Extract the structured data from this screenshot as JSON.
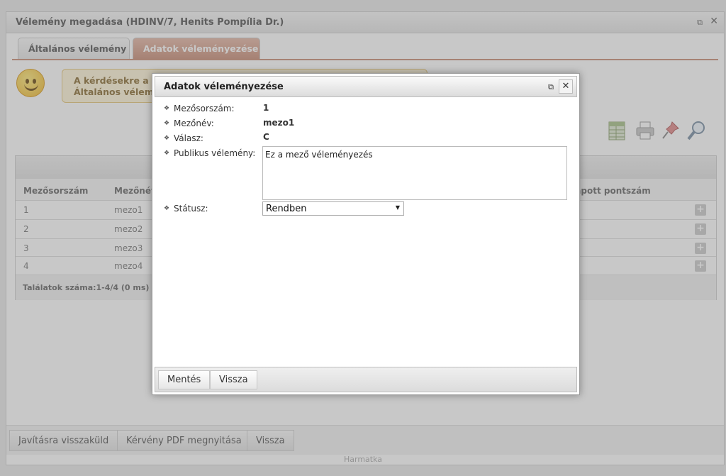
{
  "window": {
    "title": "Vélemény megadása (HDINV/7, Henits Pompília Dr.)",
    "popout_icon": "popout-icon",
    "close_icon": "close-icon"
  },
  "tabs": [
    {
      "label": "Általános vélemény",
      "active": false
    },
    {
      "label": "Adatok véleményezése",
      "active": true
    }
  ],
  "info": {
    "line1": "A kérdésekre a",
    "line2": "Általános vélem"
  },
  "toolbar": {
    "icons": [
      "xls-export-icon",
      "print-icon",
      "pin-icon",
      "search-icon"
    ]
  },
  "grid": {
    "columns": [
      "Mezősorszám",
      "Mezőnév",
      "Kapott pontszám"
    ],
    "rows": [
      {
        "num": "1",
        "name": "mezo1"
      },
      {
        "num": "2",
        "name": "mezo2"
      },
      {
        "num": "3",
        "name": "mezo3"
      },
      {
        "num": "4",
        "name": "mezo4"
      }
    ],
    "footer": "Találatok száma:1-4/4 (0 ms)"
  },
  "bottom_buttons": [
    "Javításra visszaküld",
    "Kérvény PDF megnyitása",
    "Vissza"
  ],
  "footer_text": "Harmatka",
  "dialog": {
    "title": "Adatok véleményezése",
    "fields": {
      "sorszam_label": "Mezősorszám:",
      "sorszam_value": "1",
      "nev_label": "Mezőnév:",
      "nev_value": "mezo1",
      "valasz_label": "Válasz:",
      "valasz_value": "C",
      "publikus_label": "Publikus vélemény:",
      "publikus_value": "Ez a mező véleményezés",
      "statusz_label": "Státusz:",
      "statusz_value": "Rendben"
    },
    "buttons": {
      "save": "Mentés",
      "back": "Vissza"
    }
  }
}
